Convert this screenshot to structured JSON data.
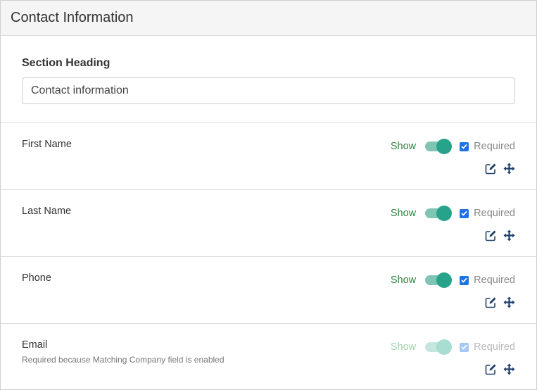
{
  "panel": {
    "title": "Contact Information"
  },
  "heading": {
    "label": "Section Heading",
    "value": "Contact information"
  },
  "fields": [
    {
      "name": "First Name",
      "note": "",
      "show_label": "Show",
      "show_on": true,
      "required_label": "Required",
      "required": true,
      "disabled": false
    },
    {
      "name": "Last Name",
      "note": "",
      "show_label": "Show",
      "show_on": true,
      "required_label": "Required",
      "required": true,
      "disabled": false
    },
    {
      "name": "Phone",
      "note": "",
      "show_label": "Show",
      "show_on": true,
      "required_label": "Required",
      "required": true,
      "disabled": false
    },
    {
      "name": "Email",
      "note": "Required because Matching Company field is enabled",
      "show_label": "Show",
      "show_on": true,
      "required_label": "Required",
      "required": true,
      "disabled": true
    }
  ],
  "icons": {
    "edit": "edit-icon",
    "move": "move-icon"
  },
  "colors": {
    "show_text": "#2e8540",
    "toggle_knob": "#26a38a",
    "toggle_track": "#80c4b6",
    "checkbox": "#1b73e8",
    "icon": "#1f3f6b"
  }
}
